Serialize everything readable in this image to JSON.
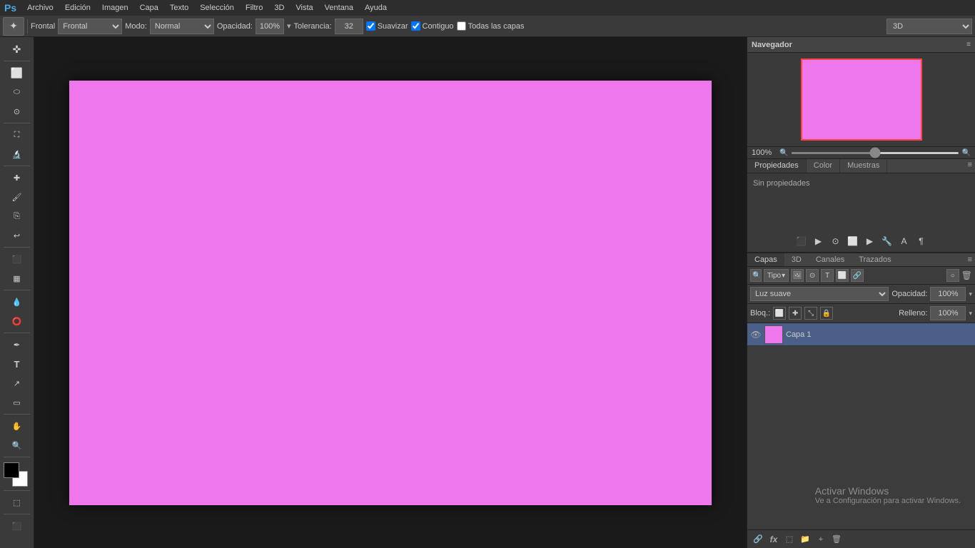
{
  "app": {
    "logo": "Ps",
    "title": "Adobe Photoshop"
  },
  "menubar": {
    "items": [
      "Archivo",
      "Edición",
      "Imagen",
      "Capa",
      "Texto",
      "Selección",
      "Filtro",
      "3D",
      "Vista",
      "Ventana",
      "Ayuda"
    ]
  },
  "toolbar": {
    "tool_label": "Frontal",
    "mode_label": "Modo:",
    "mode_value": "Normal",
    "opacity_label": "Opacidad:",
    "opacity_value": "100%",
    "tolerance_label": "Tolerancia:",
    "tolerance_value": "32",
    "smooth_label": "Suavizar",
    "contiguous_label": "Contiguo",
    "all_layers_label": "Todas las capas",
    "3d_value": "3D"
  },
  "navigator": {
    "title": "Navegador",
    "zoom_value": "100%"
  },
  "properties": {
    "tabs": [
      "Propiedades",
      "Color",
      "Muestras"
    ],
    "active_tab": "Propiedades",
    "content": "Sin propiedades"
  },
  "layers": {
    "tabs": [
      "Capas",
      "3D",
      "Canales",
      "Trazados"
    ],
    "active_tab": "Capas",
    "filter_label": "Tipo",
    "blend_mode": "Luz suave",
    "opacity_label": "Opacidad:",
    "opacity_value": "100%",
    "fill_label": "Relleno:",
    "fill_value": "100%",
    "lock_label": "Bloq.:",
    "items": [
      {
        "name": "Capa 1",
        "visible": true,
        "selected": true,
        "thumb_color": "#ee77ee"
      }
    ]
  },
  "bottom_icons": [
    "link-icon",
    "fx-icon",
    "new-adjustment-icon",
    "new-group-icon",
    "new-layer-icon",
    "delete-icon"
  ],
  "canvas": {
    "background_color": "#ee77ee"
  },
  "activate_windows": {
    "title": "Activar Windows",
    "subtitle": "Ve a Configuración para activar Windows."
  },
  "tools": [
    {
      "name": "move",
      "symbol": "✜"
    },
    {
      "name": "marquee",
      "symbol": "⬜"
    },
    {
      "name": "lasso",
      "symbol": "⬭"
    },
    {
      "name": "quick-select",
      "symbol": "⊙"
    },
    {
      "name": "crop",
      "symbol": "⛶"
    },
    {
      "name": "eyedropper",
      "symbol": "🔬"
    },
    {
      "name": "healing",
      "symbol": "🩹"
    },
    {
      "name": "brush",
      "symbol": "🖌"
    },
    {
      "name": "clone",
      "symbol": "🔗"
    },
    {
      "name": "history",
      "symbol": "↩"
    },
    {
      "name": "eraser",
      "symbol": "⬛"
    },
    {
      "name": "gradient",
      "symbol": "▦"
    },
    {
      "name": "blur",
      "symbol": "💧"
    },
    {
      "name": "dodge",
      "symbol": "⭕"
    },
    {
      "name": "pen",
      "symbol": "✒"
    },
    {
      "name": "type",
      "symbol": "T"
    },
    {
      "name": "path-select",
      "symbol": "↗"
    },
    {
      "name": "shape",
      "symbol": "▭"
    },
    {
      "name": "hand",
      "symbol": "✋"
    },
    {
      "name": "zoom",
      "symbol": "🔍"
    }
  ]
}
